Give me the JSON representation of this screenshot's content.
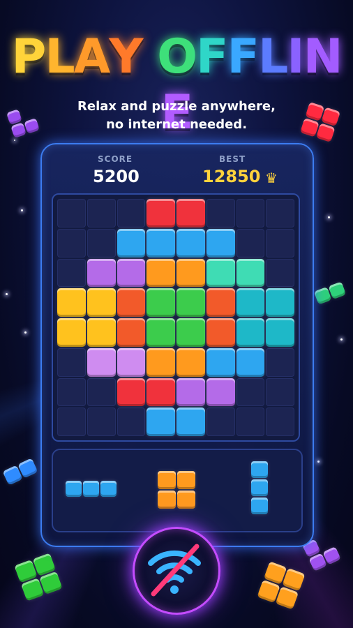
{
  "title": {
    "letters": [
      {
        "ch": "P",
        "color": "#ffd43a"
      },
      {
        "ch": "L",
        "color": "#ffb52e"
      },
      {
        "ch": "A",
        "color": "#ff9a2a"
      },
      {
        "ch": "Y",
        "color": "#ff7a2a"
      },
      {
        "ch": " ",
        "color": "#ffffff"
      },
      {
        "ch": "O",
        "color": "#3ee07a"
      },
      {
        "ch": "F",
        "color": "#2fd6c8"
      },
      {
        "ch": "F",
        "color": "#3aa8ff"
      },
      {
        "ch": "L",
        "color": "#5c7cff"
      },
      {
        "ch": "I",
        "color": "#8a62ff"
      },
      {
        "ch": "N",
        "color": "#a35cff"
      },
      {
        "ch": "E",
        "color": "#b25cff"
      }
    ]
  },
  "subtitle": {
    "line1": "Relax and puzzle anywhere,",
    "line2": "no internet needed."
  },
  "score": {
    "label": "SCORE",
    "value": "5200"
  },
  "best": {
    "label": "BEST",
    "value": "12850",
    "icon": "crown-icon"
  },
  "colors": {
    "R": "#f0323c",
    "B": "#2ea6f0",
    "P": "#b46be8",
    "O": "#ff9a1e",
    "T": "#3fdcb4",
    "Y": "#ffc21e",
    "D": "#f25a2a",
    "G": "#3ccc4c",
    "L": "#cf8cf0",
    "S": "#1eb8c8"
  },
  "board": [
    "...RR...",
    "..BBBB..",
    ".PPOOTT.",
    "YYDGGDSS",
    "YYDGGDSS",
    ".LLOOBB.",
    "..RRPP..",
    "...BB..."
  ],
  "tray_pieces": [
    {
      "name": "piece-horizontal-3",
      "color": "#2ea6f0",
      "shape": [
        "XXX"
      ]
    },
    {
      "name": "piece-square-2x2",
      "color": "#ff9a1e",
      "shape": [
        "XX",
        "XX"
      ]
    },
    {
      "name": "piece-vertical-3",
      "color": "#2ea6f0",
      "shape": [
        "X",
        "X",
        "X"
      ]
    }
  ],
  "offline_badge_icon": "no-wifi-icon"
}
